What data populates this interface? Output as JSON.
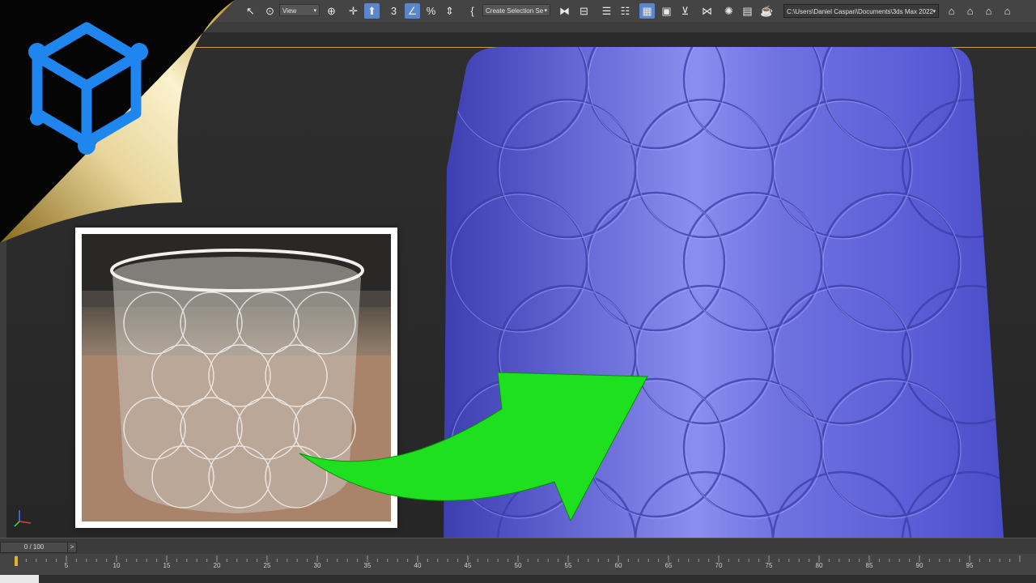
{
  "toolbar": {
    "view_dropdown": "View",
    "selection_set_dropdown": "Create Selection Se",
    "project_path": "C:\\Users\\Daniel Caspari\\Documents\\3ds Max 2022",
    "icons": [
      "undo-icon",
      "redo-icon",
      "link-icon",
      "unlink-icon",
      "bind-spacewarp-icon",
      "select-object-icon",
      "select-by-name-icon",
      "move-icon",
      "rotate-icon",
      "snap-3d-icon",
      "angle-snap-icon",
      "percent-snap-icon",
      "spinner-snap-icon",
      "named-selection-icon",
      "mirror-icon",
      "align-icon",
      "layer-explorer-icon",
      "ribbon-icon",
      "curve-editor-icon",
      "schematic-icon",
      "material-editor-icon",
      "render-setup-icon",
      "render-frame-icon",
      "render-icon",
      "project-folder-icon"
    ]
  },
  "timeline": {
    "frame_slider": "0 / 100",
    "next_label": ">",
    "ticks": [
      "5",
      "10",
      "15",
      "20",
      "25",
      "30",
      "35",
      "40",
      "45",
      "50",
      "55",
      "60",
      "65",
      "70",
      "75",
      "80",
      "85",
      "90",
      "95"
    ]
  },
  "colors": {
    "accent_blue": "#5b86c9",
    "vase_blue": "#6467d6",
    "arrow_green": "#1fe01f",
    "logo_blue": "#1f86f0",
    "curl_gold": "#d9c07a"
  }
}
